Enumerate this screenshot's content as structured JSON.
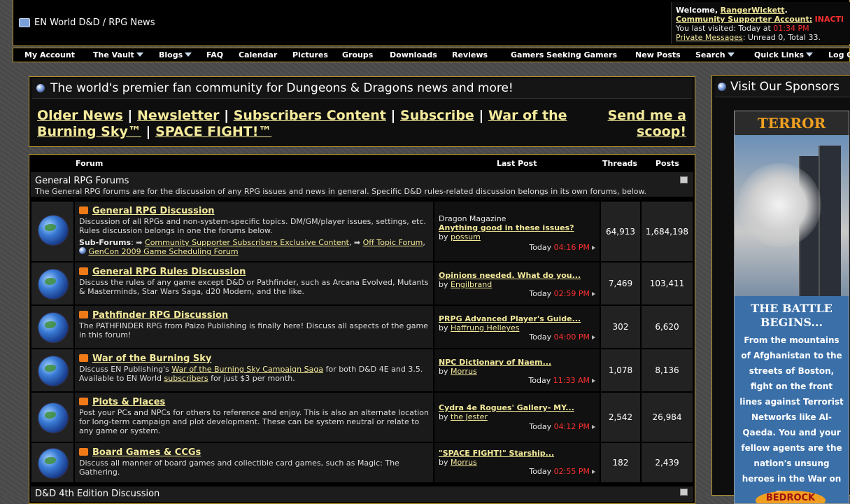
{
  "header": {
    "site_title": "EN World D&D / RPG News",
    "welcome_label": "Welcome,",
    "username": "RangerWickett",
    "account_label": "Community Supporter Account:",
    "account_status": "INACTI",
    "last_visited_label": "You last visited: Today at",
    "last_visited_time": "01:34 PM",
    "pm_label": "Private Messages",
    "pm_stats": ": Unread 0, Total 33."
  },
  "nav": {
    "items": [
      {
        "label": "My Account"
      },
      {
        "label": "The Vault"
      },
      {
        "label": "Blogs"
      },
      {
        "label": "FAQ"
      },
      {
        "label": "Calendar"
      },
      {
        "label": "Pictures"
      },
      {
        "label": "Groups"
      },
      {
        "label": "Downloads"
      },
      {
        "label": "Reviews"
      },
      {
        "label": "Gamers Seeking Gamers"
      },
      {
        "label": "New Posts"
      },
      {
        "label": "Search"
      },
      {
        "label": "Quick Links"
      },
      {
        "label": "Log O"
      }
    ]
  },
  "tagline": "The world's premier fan community for Dungeons & Dragons news and more!",
  "quicklinks": {
    "older_news": "Older News",
    "newsletter": "Newsletter",
    "subscribers_content": "Subscribers Content",
    "subscribe": "Subscribe",
    "war_of_the_burning_sky": "War of the Burning Sky™",
    "space_fight": "SPACE FIGHT!™",
    "separator": "|",
    "send_scoop": "Send me a scoop!"
  },
  "forum_table": {
    "headers": {
      "forum": "Forum",
      "last_post": "Last Post",
      "threads": "Threads",
      "posts": "Posts"
    },
    "category_1": {
      "title": "General RPG Forums",
      "description": "The General RPG forums are for the discussion of any RPG issues and news in general. Specific D&D rules-related discussion belongs in its own forums, below."
    },
    "category_2": {
      "title": "D&D 4th Edition Discussion"
    },
    "subforums_label": "Sub-Forums",
    "by_label": "by",
    "today_label": "Today",
    "forums": [
      {
        "title": "General RPG Discussion",
        "description": "Discussion of all RPGs and non-system-specific topics. DM/GM/player issues, settings, etc. Rules discussion belongs in one the forums below.",
        "subforums": [
          "Community Supporter Subscribers Exclusive Content",
          "Off Topic Forum",
          "GenCon 2009 Game Scheduling Forum"
        ],
        "last_post_prefix": "Dragon Magazine",
        "last_post_title": "Anything good in these issues?",
        "last_post_by": "possum",
        "last_post_time": "04:16 PM",
        "threads": "64,913",
        "posts": "1,684,198"
      },
      {
        "title": "General RPG Rules Discussion",
        "description": "Discuss the rules of any game except D&D or Pathfinder, such as Arcana Evolved, Mutants & Masterminds, Star Wars Saga, d20 Modern, and the like.",
        "last_post_title": "Opinions needed. What do you...",
        "last_post_by": "Engilbrand",
        "last_post_time": "02:59 PM",
        "threads": "7,469",
        "posts": "103,411"
      },
      {
        "title": "Pathfinder RPG Discussion",
        "description": "The PATHFINDER RPG from Paizo Publishing is finally here! Discuss all aspects of the game in this forum!",
        "last_post_title": "PRPG Advanced Player's Guide...",
        "last_post_by": "Haffrung Helleyes",
        "last_post_time": "04:00 PM",
        "threads": "302",
        "posts": "6,620"
      },
      {
        "title": "War of the Burning Sky",
        "description_pre": "Discuss EN Publishing's",
        "description_link": "War of the Burning Sky Campaign Saga",
        "description_mid": "for both D&D 4E and 3.5. Available to EN World",
        "description_link2": "subscribers",
        "description_post": "for just $3 per month.",
        "last_post_title": "NPC Dictionary of Naem...",
        "last_post_by": "Morrus",
        "last_post_time": "11:33 AM",
        "threads": "1,078",
        "posts": "8,136"
      },
      {
        "title": "Plots & Places",
        "description": "Post your PCs and NPCs for others to reference and enjoy. This is also an alternate location for long-term campaign and plot development. These can be system neutral or relate to any game or system.",
        "last_post_title": "Cydra 4e Rogues' Gallery- MY...",
        "last_post_by": "the Jester",
        "last_post_time": "04:12 PM",
        "threads": "2,542",
        "posts": "26,984"
      },
      {
        "title": "Board Games & CCGs",
        "description": "Discuss all manner of board games and collectible card games, such as Magic: The Gathering.",
        "last_post_title": "\"SPACE FIGHT!\" Starship...",
        "last_post_by": "Morrus",
        "last_post_time": "02:55 PM",
        "threads": "182",
        "posts": "2,439"
      }
    ]
  },
  "sponsors": {
    "heading": "Visit Our Sponsors",
    "ad_banner": "TERROR NETWORK",
    "ad_headline": "THE BATTLE BEGINS...",
    "ad_body": "From the mountains of Afghanistan to the streets of Boston, fight on the front lines against Terrorist Networks like Al-Qaeda. You and your fellow agents are the nation's unsung heroes in the War on Terror.",
    "ad_logo": "BEDROCK"
  }
}
